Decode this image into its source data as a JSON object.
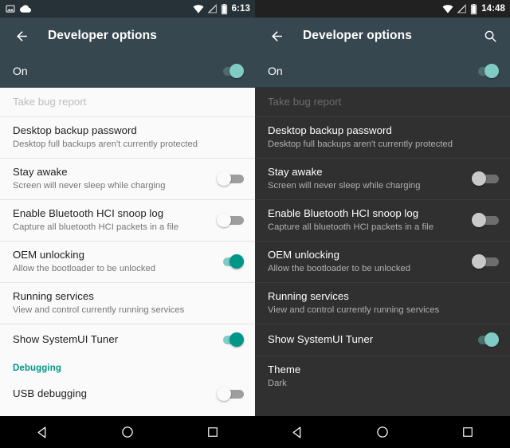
{
  "panels": [
    {
      "id": "light-panel",
      "theme": "light",
      "statusbar": {
        "time": "6:13",
        "left_icons": [
          "screenshot-icon",
          "cloud-upload-icon"
        ],
        "right_icons": [
          "wifi-icon",
          "signal-off-icon",
          "battery-icon"
        ]
      },
      "appbar": {
        "back_icon": "back-arrow-icon",
        "title": "Developer options",
        "search_icon": null
      },
      "master": {
        "label": "On",
        "state": "on"
      },
      "rows": [
        {
          "kind": "row",
          "title": "Take bug report",
          "sub": "",
          "disabled": true,
          "control": "none"
        },
        {
          "kind": "row",
          "title": "Desktop backup password",
          "sub": "Desktop full backups aren't currently protected",
          "disabled": false,
          "control": "none"
        },
        {
          "kind": "row",
          "title": "Stay awake",
          "sub": "Screen will never sleep while charging",
          "disabled": false,
          "control": "switch",
          "state": "off"
        },
        {
          "kind": "row",
          "title": "Enable Bluetooth HCI snoop log",
          "sub": "Capture all bluetooth HCI packets in a file",
          "disabled": false,
          "control": "switch",
          "state": "off"
        },
        {
          "kind": "row",
          "title": "OEM unlocking",
          "sub": "Allow the bootloader to be unlocked",
          "disabled": false,
          "control": "switch",
          "state": "on"
        },
        {
          "kind": "row",
          "title": "Running services",
          "sub": "View and control currently running services",
          "disabled": false,
          "control": "none"
        },
        {
          "kind": "row",
          "title": "Show SystemUI Tuner",
          "sub": "",
          "disabled": false,
          "control": "switch",
          "state": "on"
        },
        {
          "kind": "section",
          "title": "Debugging"
        },
        {
          "kind": "row",
          "title": "USB debugging",
          "sub": "",
          "disabled": false,
          "control": "switch",
          "state": "off",
          "clipped": true
        }
      ],
      "navbar": {
        "back": "nav-back-icon",
        "home": "nav-home-icon",
        "recents": "nav-recents-icon"
      }
    },
    {
      "id": "dark-panel",
      "theme": "dark",
      "statusbar": {
        "time": "14:48",
        "left_icons": [],
        "right_icons": [
          "wifi-icon",
          "signal-off-icon",
          "battery-icon"
        ]
      },
      "appbar": {
        "back_icon": "back-arrow-icon",
        "title": "Developer options",
        "search_icon": "search-icon"
      },
      "master": {
        "label": "On",
        "state": "on"
      },
      "rows": [
        {
          "kind": "row",
          "title": "Take bug report",
          "sub": "",
          "disabled": true,
          "control": "none"
        },
        {
          "kind": "row",
          "title": "Desktop backup password",
          "sub": "Desktop full backups aren't currently protected",
          "disabled": false,
          "control": "none"
        },
        {
          "kind": "row",
          "title": "Stay awake",
          "sub": "Screen will never sleep while charging",
          "disabled": false,
          "control": "switch",
          "state": "off"
        },
        {
          "kind": "row",
          "title": "Enable Bluetooth HCI snoop log",
          "sub": "Capture all bluetooth HCI packets in a file",
          "disabled": false,
          "control": "switch",
          "state": "off"
        },
        {
          "kind": "row",
          "title": "OEM unlocking",
          "sub": "Allow the bootloader to be unlocked",
          "disabled": false,
          "control": "switch",
          "state": "off"
        },
        {
          "kind": "row",
          "title": "Running services",
          "sub": "View and control currently running services",
          "disabled": false,
          "control": "none"
        },
        {
          "kind": "row",
          "title": "Show SystemUI Tuner",
          "sub": "",
          "disabled": false,
          "control": "switch",
          "state": "on"
        },
        {
          "kind": "row",
          "title": "Theme",
          "sub": "Dark",
          "disabled": false,
          "control": "none"
        }
      ],
      "navbar": {
        "back": "nav-back-icon",
        "home": "nav-home-icon",
        "recents": "nav-recents-icon"
      }
    }
  ],
  "colors": {
    "appbar": "#37474F",
    "statusbar_light_panel": "#263238",
    "statusbar_dark_panel": "#212121",
    "accent_teal": "#009688",
    "accent_teal_light": "#80CBC4",
    "light_bg": "#FAFAFA",
    "dark_bg": "#303030",
    "navbar": "#000000"
  }
}
